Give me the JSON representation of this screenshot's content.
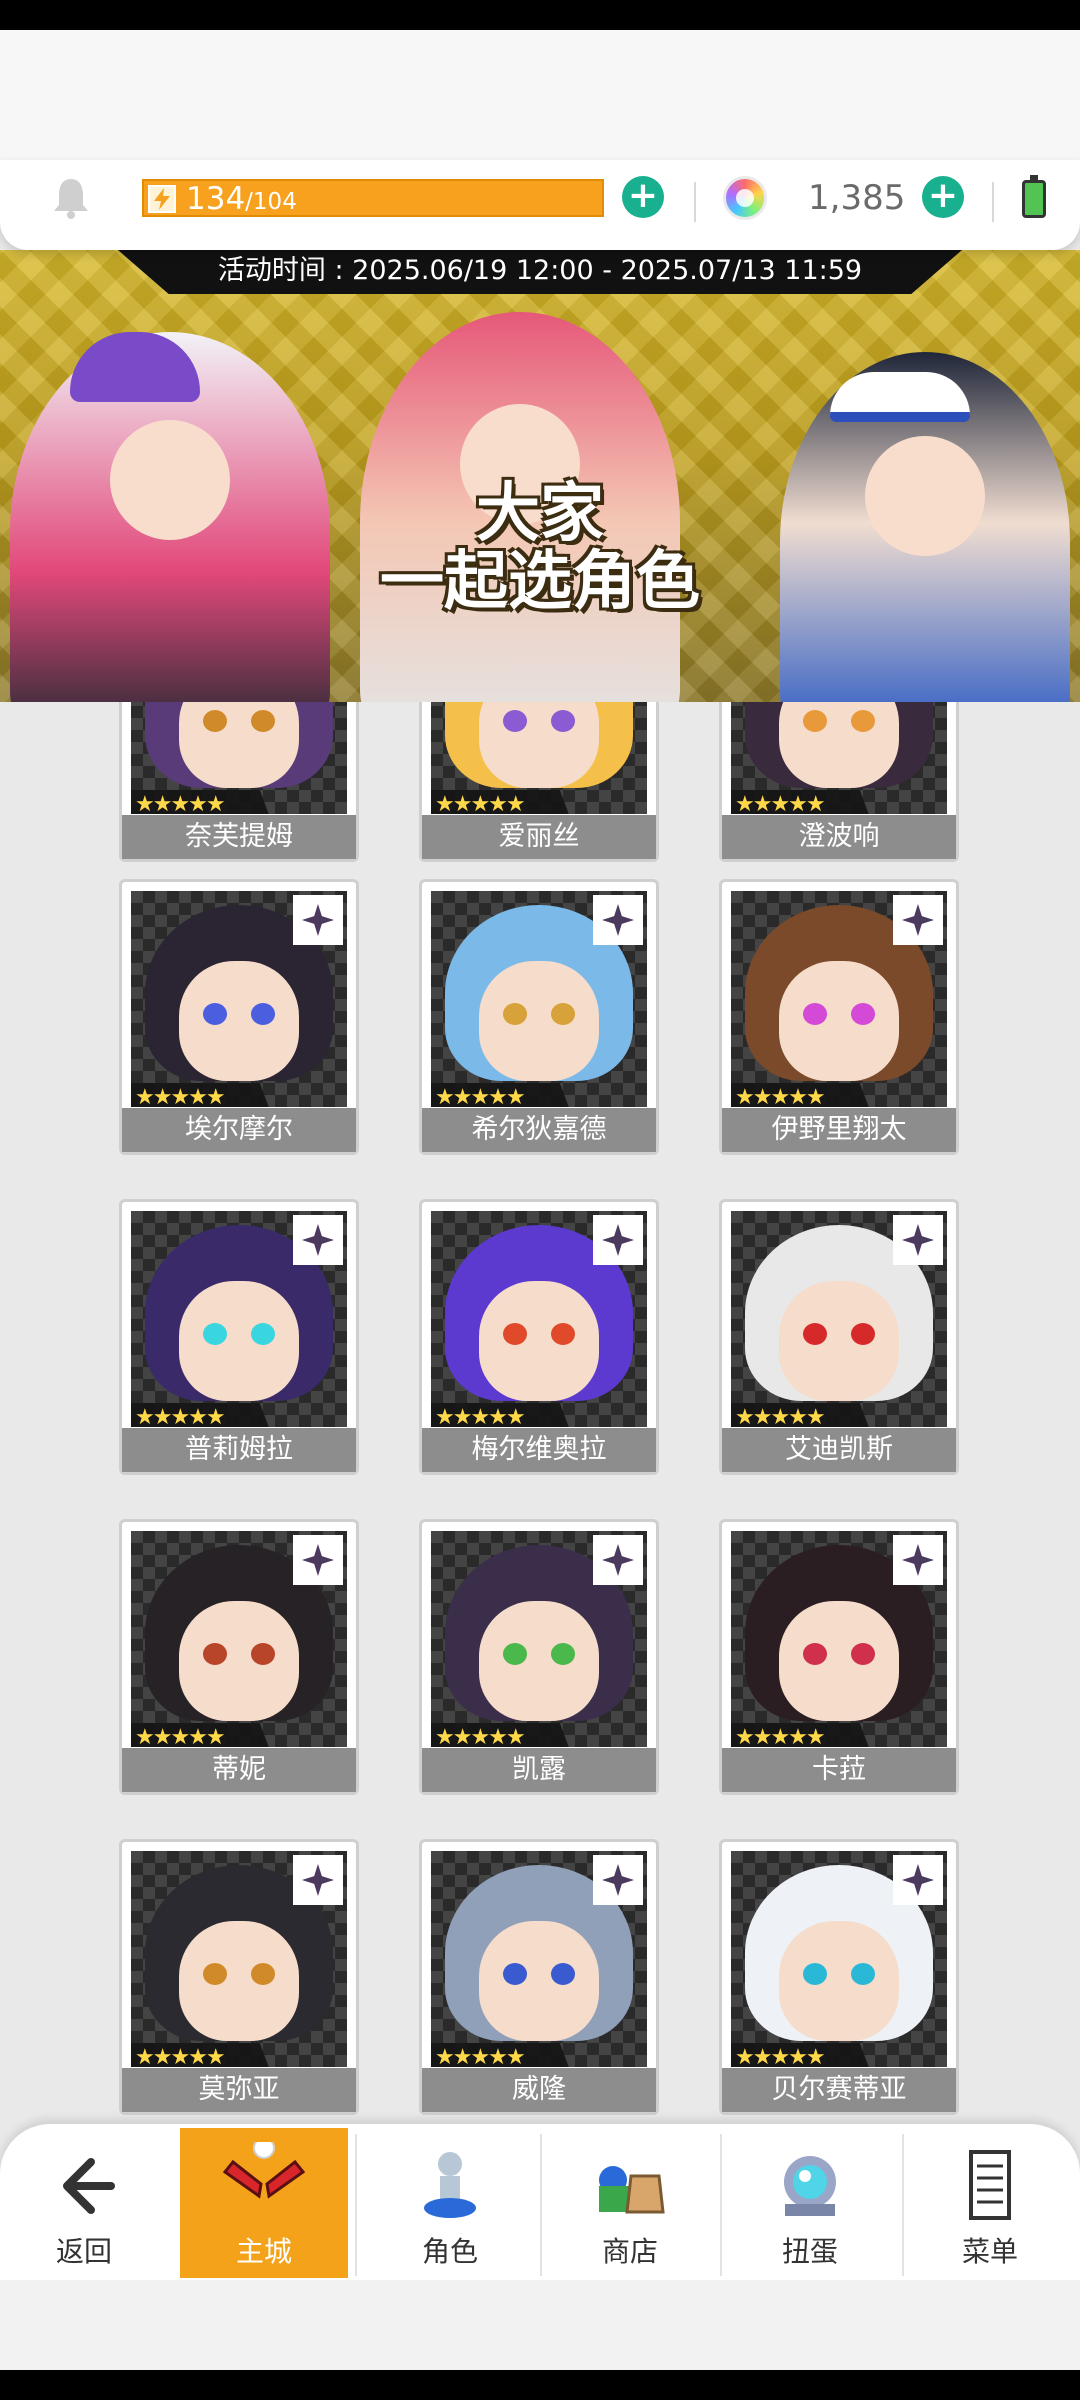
{
  "header": {
    "stamina_current": "134",
    "stamina_max": "/104",
    "gem_count": "1,385"
  },
  "banner": {
    "event_period": "活动时间 : 2025.06/19 12:00 - 2025.07/13 11:59",
    "title_line1": "大家",
    "title_line2": "一起选角色"
  },
  "characters": [
    {
      "name": "奈芙提姆",
      "stars": "★★★★★",
      "hair": "#5a3b7a",
      "eye": "#d08a2a"
    },
    {
      "name": "爱丽丝",
      "stars": "★★★★★",
      "hair": "#f4c04a",
      "eye": "#8a5bd2"
    },
    {
      "name": "澄波响",
      "stars": "★★★★★",
      "hair": "#3a2a3e",
      "eye": "#e89a3a"
    },
    {
      "name": "埃尔摩尔",
      "stars": "★★★★★",
      "hair": "#2a2433",
      "eye": "#4b5ee0"
    },
    {
      "name": "希尔狄嘉德",
      "stars": "★★★★★",
      "hair": "#7bb9e8",
      "eye": "#d8a23a"
    },
    {
      "name": "伊野里翔太",
      "stars": "★★★★★",
      "hair": "#7a4a2a",
      "eye": "#d44ad6"
    },
    {
      "name": "普莉姆拉",
      "stars": "★★★★★",
      "hair": "#3a2a6a",
      "eye": "#3ad6e0"
    },
    {
      "name": "梅尔维奥拉",
      "stars": "★★★★★",
      "hair": "#5c3ad0",
      "eye": "#e04a2a"
    },
    {
      "name": "艾迪凯斯",
      "stars": "★★★★★",
      "hair": "#e8e8e8",
      "eye": "#d62a2a"
    },
    {
      "name": "蒂妮",
      "stars": "★★★★★",
      "hair": "#262226",
      "eye": "#b8442a"
    },
    {
      "name": "凯露",
      "stars": "★★★★★",
      "hair": "#3a2e4a",
      "eye": "#4ab84a"
    },
    {
      "name": "卡菈",
      "stars": "★★★★★",
      "hair": "#2a1e22",
      "eye": "#d0304a"
    },
    {
      "name": "莫弥亚",
      "stars": "★★★★★",
      "hair": "#2a2a30",
      "eye": "#d08a2a"
    },
    {
      "name": "威隆",
      "stars": "★★★★★",
      "hair": "#8fa0b8",
      "eye": "#3a5ad0"
    },
    {
      "name": "贝尔赛蒂亚",
      "stars": "★★★★★",
      "hair": "#eef2f6",
      "eye": "#2ab8d6"
    }
  ],
  "nav": {
    "back": "返回",
    "main_city": "主城",
    "characters": "角色",
    "shop": "商店",
    "gacha": "扭蛋",
    "menu": "菜单"
  },
  "colors": {
    "accent": "#f5a21b",
    "plus_button": "#18b08e",
    "card_name_bg": "#8d8d8d",
    "banner_bg": "#c2a21d"
  },
  "icons": {
    "bell": "bell-icon",
    "stamina": "lightning-icon",
    "gem": "rainbow-gem-icon",
    "battery": "battery-icon",
    "back": "arrow-left-icon",
    "main_city": "red-wings-icon",
    "characters": "character-figure-icon",
    "shop": "shop-bag-icon",
    "gacha": "gacha-orb-icon",
    "menu": "notebook-icon",
    "card_badge": "sparkle-diamond-icon"
  }
}
